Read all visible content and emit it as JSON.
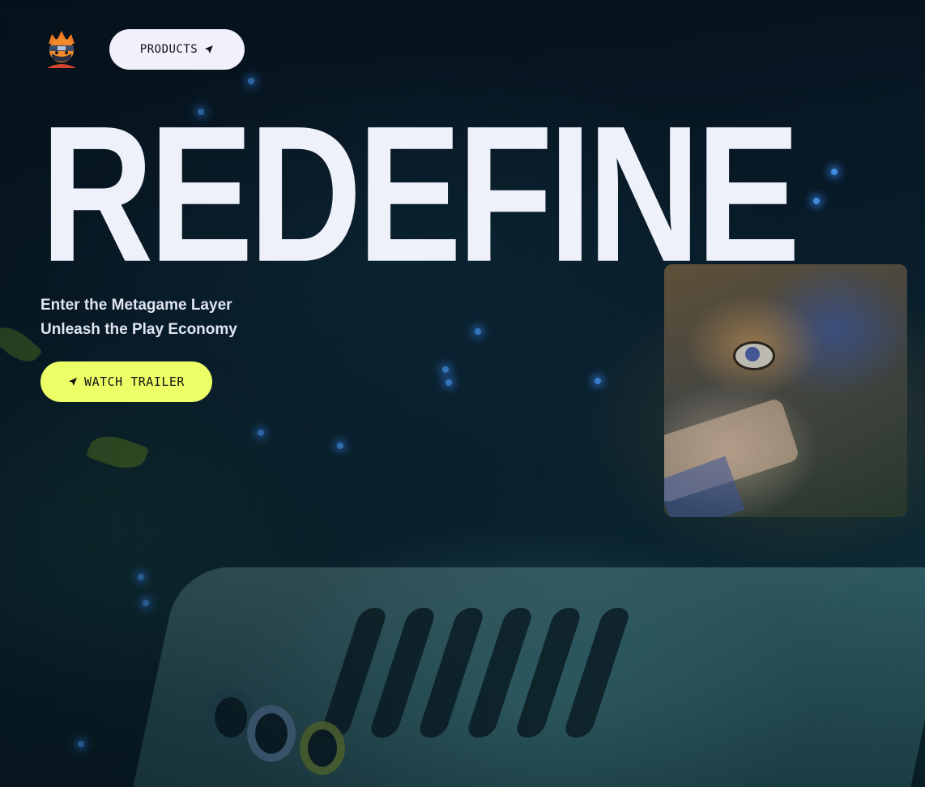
{
  "nav": {
    "products_label": "PRODUCTS"
  },
  "hero": {
    "headline": "REDEFINE",
    "subtitle_line1": "Enter the Metagame Layer",
    "subtitle_line2": "Unleash the Play Economy",
    "cta_label": "WATCH TRAILER"
  },
  "icons": {
    "logo": "ninja-avatar-logo",
    "products": "send-arrow-icon",
    "cta": "send-arrow-icon"
  },
  "colors": {
    "accent": "#edff66",
    "nav_button_bg": "#f1f0fb",
    "headline": "#eef0fa"
  }
}
